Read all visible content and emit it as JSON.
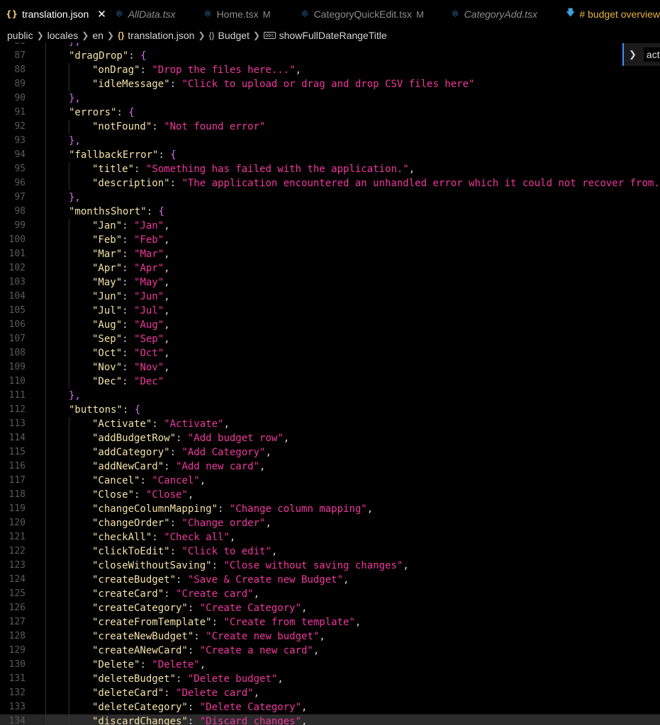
{
  "tabs": [
    {
      "label": "translation.json",
      "icon": "json-braces-icon",
      "active": true,
      "close": "✕"
    },
    {
      "label": "AllData.tsx",
      "icon": "react-icon",
      "italic": true
    },
    {
      "label": "Home.tsx",
      "icon": "react-icon",
      "modified": "M"
    },
    {
      "label": "CategoryQuickEdit.tsx",
      "icon": "react-icon",
      "modified": "M"
    },
    {
      "label": "CategoryAdd.tsx",
      "icon": "react-icon",
      "italic": true
    },
    {
      "label": "# budget overview",
      "icon": "markdown-download-icon"
    }
  ],
  "breadcrumb": [
    "public",
    "locales",
    "en",
    "translation.json",
    "Budget",
    "showFullDateRangeTitle"
  ],
  "side_widget": {
    "label": "actio"
  },
  "colors": {
    "key": "#f4e1a8",
    "string": "#f0379e",
    "bracket_level1": "#d76ef0",
    "bracket_level2": "#ffd700",
    "line_number": "#5a5a5a",
    "background": "#000000"
  },
  "editor": {
    "lines": [
      {
        "n": "86",
        "indent": 1,
        "key": "",
        "value": "",
        "open": "",
        "close": "},"
      },
      {
        "n": "87",
        "indent": 1,
        "key": "\"dragDrop\"",
        "value": "",
        "open": "{",
        "close": ""
      },
      {
        "n": "88",
        "indent": 2,
        "key": "\"onDrag\"",
        "value": "\"Drop the files here...\"",
        "comma": ","
      },
      {
        "n": "89",
        "indent": 2,
        "key": "\"idleMessage\"",
        "value": "\"Click to upload or drag and drop CSV files here\"",
        "comma": ""
      },
      {
        "n": "90",
        "indent": 1,
        "key": "",
        "value": "",
        "open": "",
        "close": "},"
      },
      {
        "n": "91",
        "indent": 1,
        "key": "\"errors\"",
        "value": "",
        "open": "{",
        "close": ""
      },
      {
        "n": "92",
        "indent": 2,
        "key": "\"notFound\"",
        "value": "\"Not found error\"",
        "comma": ""
      },
      {
        "n": "93",
        "indent": 1,
        "key": "",
        "value": "",
        "open": "",
        "close": "},"
      },
      {
        "n": "94",
        "indent": 1,
        "key": "\"fallbackError\"",
        "value": "",
        "open": "{",
        "close": ""
      },
      {
        "n": "95",
        "indent": 2,
        "key": "\"title\"",
        "value": "\"Something has failed with the application.\"",
        "comma": ","
      },
      {
        "n": "96",
        "indent": 2,
        "key": "\"description\"",
        "value": "\"The application encountered an unhandled error which it could not recover from.\"",
        "comma": ""
      },
      {
        "n": "97",
        "indent": 1,
        "key": "",
        "value": "",
        "open": "",
        "close": "},"
      },
      {
        "n": "98",
        "indent": 1,
        "key": "\"monthsShort\"",
        "value": "",
        "open": "{",
        "close": ""
      },
      {
        "n": "99",
        "indent": 2,
        "key": "\"Jan\"",
        "value": "\"Jan\"",
        "comma": ","
      },
      {
        "n": "100",
        "indent": 2,
        "key": "\"Feb\"",
        "value": "\"Feb\"",
        "comma": ","
      },
      {
        "n": "101",
        "indent": 2,
        "key": "\"Mar\"",
        "value": "\"Mar\"",
        "comma": ","
      },
      {
        "n": "102",
        "indent": 2,
        "key": "\"Apr\"",
        "value": "\"Apr\"",
        "comma": ","
      },
      {
        "n": "103",
        "indent": 2,
        "key": "\"May\"",
        "value": "\"May\"",
        "comma": ","
      },
      {
        "n": "104",
        "indent": 2,
        "key": "\"Jun\"",
        "value": "\"Jun\"",
        "comma": ","
      },
      {
        "n": "105",
        "indent": 2,
        "key": "\"Jul\"",
        "value": "\"Jul\"",
        "comma": ","
      },
      {
        "n": "106",
        "indent": 2,
        "key": "\"Aug\"",
        "value": "\"Aug\"",
        "comma": ","
      },
      {
        "n": "107",
        "indent": 2,
        "key": "\"Sep\"",
        "value": "\"Sep\"",
        "comma": ","
      },
      {
        "n": "108",
        "indent": 2,
        "key": "\"Oct\"",
        "value": "\"Oct\"",
        "comma": ","
      },
      {
        "n": "109",
        "indent": 2,
        "key": "\"Nov\"",
        "value": "\"Nov\"",
        "comma": ","
      },
      {
        "n": "110",
        "indent": 2,
        "key": "\"Dec\"",
        "value": "\"Dec\"",
        "comma": ""
      },
      {
        "n": "111",
        "indent": 1,
        "key": "",
        "value": "",
        "open": "",
        "close": "},"
      },
      {
        "n": "112",
        "indent": 1,
        "key": "\"buttons\"",
        "value": "",
        "open": "{",
        "close": ""
      },
      {
        "n": "113",
        "indent": 2,
        "key": "\"Activate\"",
        "value": "\"Activate\"",
        "comma": ","
      },
      {
        "n": "114",
        "indent": 2,
        "key": "\"addBudgetRow\"",
        "value": "\"Add budget row\"",
        "comma": ","
      },
      {
        "n": "115",
        "indent": 2,
        "key": "\"addCategory\"",
        "value": "\"Add Category\"",
        "comma": ","
      },
      {
        "n": "116",
        "indent": 2,
        "key": "\"addNewCard\"",
        "value": "\"Add new card\"",
        "comma": ","
      },
      {
        "n": "117",
        "indent": 2,
        "key": "\"Cancel\"",
        "value": "\"Cancel\"",
        "comma": ","
      },
      {
        "n": "118",
        "indent": 2,
        "key": "\"Close\"",
        "value": "\"Close\"",
        "comma": ","
      },
      {
        "n": "119",
        "indent": 2,
        "key": "\"changeColumnMapping\"",
        "value": "\"Change column mapping\"",
        "comma": ","
      },
      {
        "n": "120",
        "indent": 2,
        "key": "\"changeOrder\"",
        "value": "\"Change order\"",
        "comma": ","
      },
      {
        "n": "121",
        "indent": 2,
        "key": "\"checkAll\"",
        "value": "\"Check all\"",
        "comma": ","
      },
      {
        "n": "122",
        "indent": 2,
        "key": "\"clickToEdit\"",
        "value": "\"Click to edit\"",
        "comma": ","
      },
      {
        "n": "123",
        "indent": 2,
        "key": "\"closeWithoutSaving\"",
        "value": "\"Close without saving changes\"",
        "comma": ","
      },
      {
        "n": "124",
        "indent": 2,
        "key": "\"createBudget\"",
        "value": "\"Save & Create new Budget\"",
        "comma": ","
      },
      {
        "n": "125",
        "indent": 2,
        "key": "\"createCard\"",
        "value": "\"Create card\"",
        "comma": ","
      },
      {
        "n": "126",
        "indent": 2,
        "key": "\"createCategory\"",
        "value": "\"Create Category\"",
        "comma": ","
      },
      {
        "n": "127",
        "indent": 2,
        "key": "\"createFromTemplate\"",
        "value": "\"Create from template\"",
        "comma": ","
      },
      {
        "n": "128",
        "indent": 2,
        "key": "\"createNewBudget\"",
        "value": "\"Create new budget\"",
        "comma": ","
      },
      {
        "n": "129",
        "indent": 2,
        "key": "\"createANewCard\"",
        "value": "\"Create a new card\"",
        "comma": ","
      },
      {
        "n": "130",
        "indent": 2,
        "key": "\"Delete\"",
        "value": "\"Delete\"",
        "comma": ","
      },
      {
        "n": "131",
        "indent": 2,
        "key": "\"deleteBudget\"",
        "value": "\"Delete budget\"",
        "comma": ","
      },
      {
        "n": "132",
        "indent": 2,
        "key": "\"deleteCard\"",
        "value": "\"Delete card\"",
        "comma": ","
      },
      {
        "n": "133",
        "indent": 2,
        "key": "\"deleteCategory\"",
        "value": "\"Delete Category\"",
        "comma": ","
      },
      {
        "n": "134",
        "indent": 2,
        "key": "\"discardChanges\"",
        "value": "\"Discard changes\"",
        "comma": ",",
        "highlight": true
      }
    ]
  }
}
